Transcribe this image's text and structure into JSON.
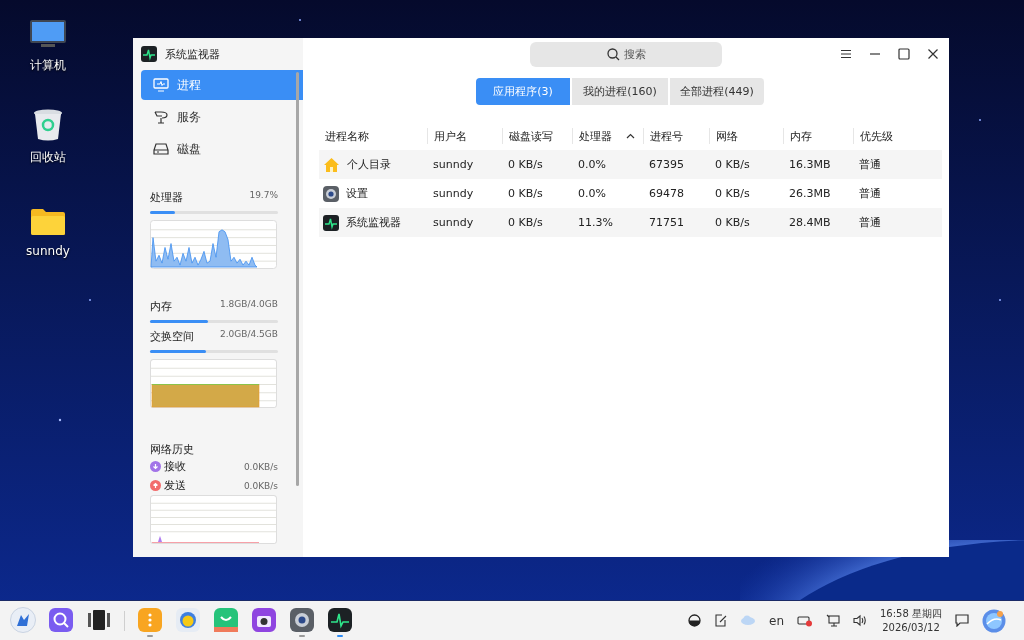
{
  "desktop_icons": [
    {
      "label": "计算机"
    },
    {
      "label": "回收站"
    },
    {
      "label": "sunndy"
    }
  ],
  "window": {
    "title": "系统监视器",
    "search": {
      "placeholder": "搜索"
    }
  },
  "sidebar": {
    "items": [
      {
        "label": "进程",
        "selected": true
      },
      {
        "label": "服务",
        "selected": false
      },
      {
        "label": "磁盘",
        "selected": false
      }
    ],
    "cpu": {
      "label": "处理器",
      "reading": "19.7%",
      "level": 0.197
    },
    "memory": {
      "label": "内存",
      "reading": "1.8GB/4.0GB",
      "level": 0.45
    },
    "swap": {
      "label": "交换空间",
      "reading": "2.0GB/4.5GB",
      "level": 0.44
    },
    "network": {
      "title": "网络历史",
      "rows": [
        {
          "label": "接收",
          "reading": "0.0KB/s",
          "color": "#a274e8"
        },
        {
          "label": "发送",
          "reading": "0.0KB/s",
          "color": "#f26d6d"
        }
      ]
    }
  },
  "tabs": [
    {
      "label": "应用程序(3)",
      "selected": true
    },
    {
      "label": "我的进程(160)",
      "selected": false
    },
    {
      "label": "全部进程(449)",
      "selected": false
    }
  ],
  "table": {
    "columns": [
      {
        "label": "进程名称",
        "sorted": false
      },
      {
        "label": "用户名",
        "sorted": false
      },
      {
        "label": "磁盘读写",
        "sorted": false
      },
      {
        "label": "处理器",
        "sorted": true
      },
      {
        "label": "进程号",
        "sorted": false
      },
      {
        "label": "网络",
        "sorted": false
      },
      {
        "label": "内存",
        "sorted": false
      },
      {
        "label": "优先级",
        "sorted": false
      }
    ],
    "rows": [
      {
        "cells": [
          "个人目录",
          "sunndy",
          "0 KB/s",
          "0.0%",
          "67395",
          "0 KB/s",
          "16.3MB",
          "普通"
        ]
      },
      {
        "cells": [
          "设置",
          "sunndy",
          "0 KB/s",
          "0.0%",
          "69478",
          "0 KB/s",
          "26.3MB",
          "普通"
        ]
      },
      {
        "cells": [
          "系统监视器",
          "sunndy",
          "0 KB/s",
          "11.3%",
          "71751",
          "0 KB/s",
          "28.4MB",
          "普通"
        ]
      }
    ]
  },
  "taskbar": {
    "apps": [
      {
        "running": false,
        "selected": false
      },
      {
        "running": false,
        "selected": false
      },
      {
        "running": false,
        "selected": false
      },
      {
        "running": true,
        "selected": false
      },
      {
        "running": false,
        "selected": false
      },
      {
        "running": false,
        "selected": false
      },
      {
        "running": false,
        "selected": false
      },
      {
        "running": true,
        "selected": false
      },
      {
        "running": true,
        "selected": true
      }
    ],
    "tray": {
      "language": "en",
      "time": "16:58 星期四",
      "date": "2026/03/12"
    }
  }
}
